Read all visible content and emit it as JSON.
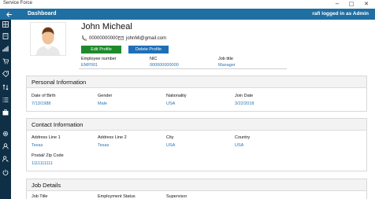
{
  "window": {
    "app_title": "Service Force",
    "minimize": "−",
    "maximize": "□",
    "close": "✕"
  },
  "header": {
    "back_icon": "arrow-left-icon",
    "title": "Dashboard",
    "user_status": "rafi logged in as Admin",
    "color": "#1f6fa3"
  },
  "sidebar": {
    "color": "#0e2f46",
    "items": [
      {
        "icon": "grid-icon"
      },
      {
        "icon": "building-icon"
      },
      {
        "icon": "bar-chart-icon"
      },
      {
        "icon": "cart-icon"
      },
      {
        "icon": "tag-icon"
      },
      {
        "icon": "sort-icon"
      },
      {
        "icon": "list-icon"
      },
      {
        "icon": "briefcase-icon"
      },
      {
        "icon": "gear-icon"
      },
      {
        "icon": "user-icon"
      },
      {
        "icon": "user-key-icon"
      },
      {
        "icon": "power-icon"
      }
    ]
  },
  "profile": {
    "name": "John Micheal",
    "phone": "00000000000",
    "email": "johnMi@gmail.com",
    "edit_label": "Edit Profile",
    "delete_label": "Delete Profile",
    "employee_number_label": "Employee number",
    "employee_number": "EMP001",
    "nic_label": "NIC",
    "nic": "000000000000",
    "job_title_label": "Job title",
    "job_title": "Manager"
  },
  "personal": {
    "heading": "Personal Information",
    "dob_label": "Date of Birth",
    "dob": "7/13/1988",
    "gender_label": "Gender",
    "gender": "Male",
    "nationality_label": "Nationality",
    "nationality": "USA",
    "join_label": "Join Date",
    "join": "3/22/2018"
  },
  "contact": {
    "heading": "Contact Information",
    "addr1_label": "Address Line 1",
    "addr1": "Texas",
    "addr2_label": "Address Line 2",
    "addr2": "Texas",
    "city_label": "City",
    "city": "USA",
    "country_label": "Country",
    "country": "USA",
    "postal_label": "Postal/ Zip Code",
    "postal": "1111111111"
  },
  "job": {
    "heading": "Job Details",
    "title_label": "Job Title",
    "status_label": "Employment Status",
    "supervisor_label": "Supervisor"
  }
}
